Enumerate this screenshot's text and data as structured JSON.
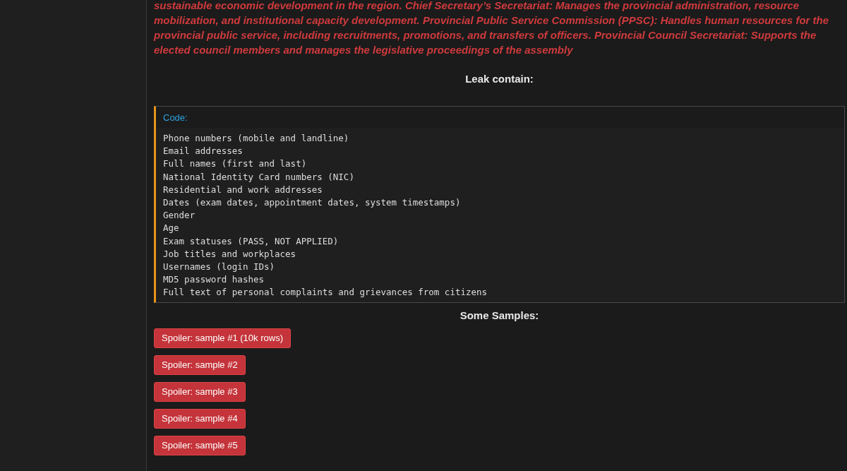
{
  "post": {
    "paragraph": "sustainable economic development in the region. Chief Secretary’s Secretariat: Manages the provincial administration, resource mobilization, and institutional capacity development. Provincial Public Service Commission (PPSC): Handles human resources for the provincial public service, including recruitments, promotions, and transfers of officers. Provincial Council Secretariat: Supports the elected council members and manages the legislative proceedings of the assembly",
    "leak_heading": "Leak contain:",
    "code_block": {
      "label": "Code:",
      "lines": [
        "Phone numbers (mobile and landline)",
        "Email addresses",
        "Full names (first and last)",
        "National Identity Card numbers (NIC)",
        "Residential and work addresses",
        "Dates (exam dates, appointment dates, system timestamps)",
        "Gender",
        "Age",
        "Exam statuses (PASS, NOT APPLIED)",
        "Job titles and workplaces",
        "Usernames (login IDs)",
        "MD5 password hashes",
        "Full text of personal complaints and grievances from citizens"
      ]
    },
    "samples_heading": "Some Samples:",
    "spoilers": [
      "Spoiler: sample #1 (10k rows)",
      "Spoiler: sample #2",
      "Spoiler: sample #3",
      "Spoiler: sample #4",
      "Spoiler: sample #5"
    ]
  }
}
